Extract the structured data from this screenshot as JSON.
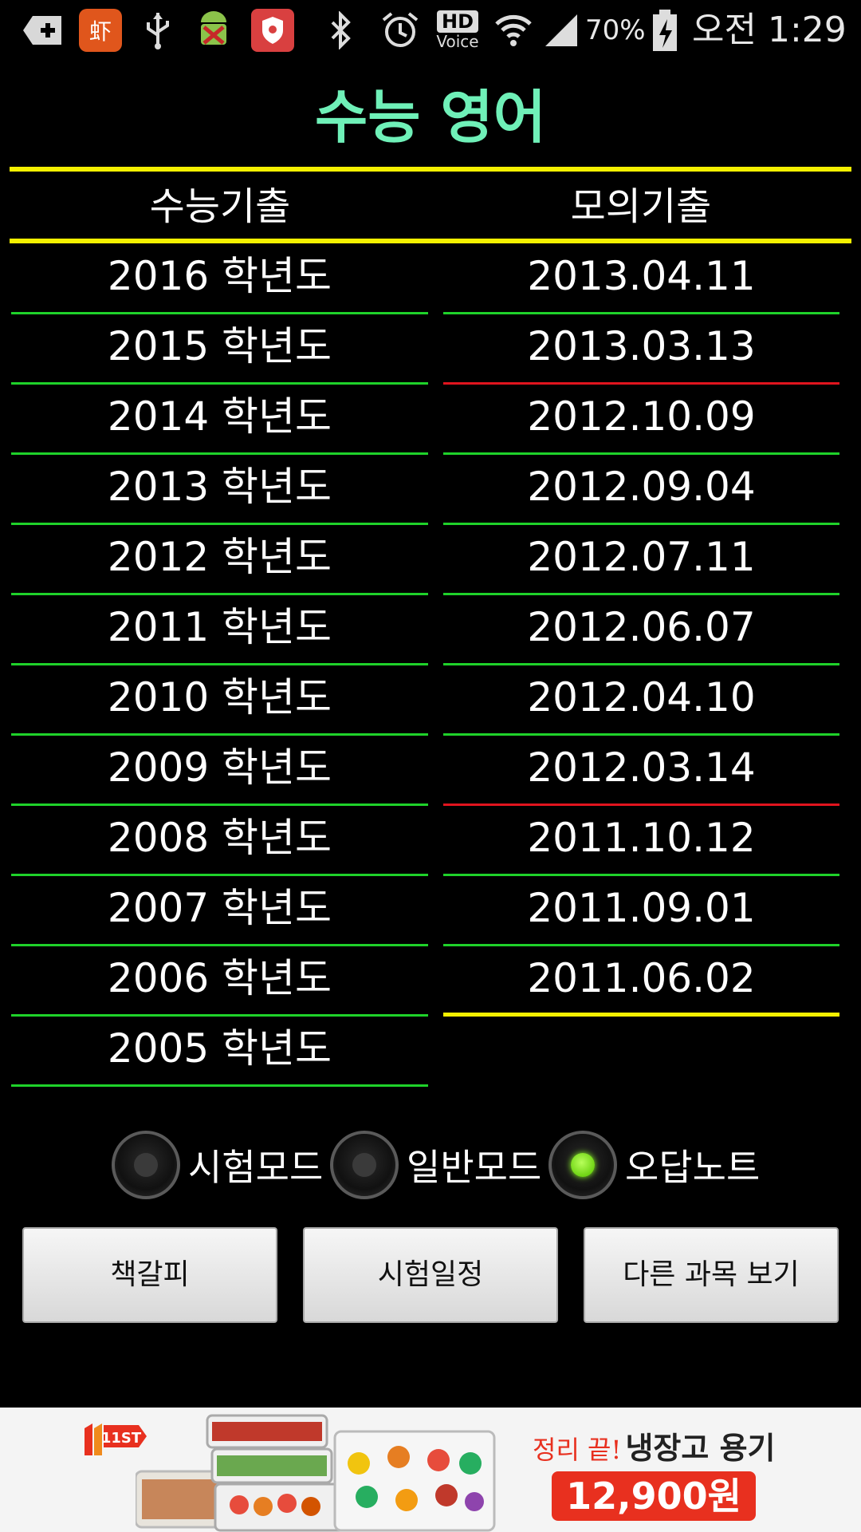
{
  "status_bar": {
    "icons": [
      "plus-icon",
      "app-icon",
      "usb-icon",
      "android-debug-icon",
      "shield-icon",
      "bluetooth-icon",
      "alarm-icon",
      "hd-voice-icon",
      "wifi-icon",
      "signal-icon",
      "battery-icon"
    ],
    "hd": "HD",
    "voice": "Voice",
    "battery": "70%",
    "time": "오전 1:29"
  },
  "title": "수능 영어",
  "columns": {
    "left_header": "수능기출",
    "right_header": "모의기출"
  },
  "suneung_items": [
    {
      "label": "2016 학년도",
      "line": "green"
    },
    {
      "label": "2015 학년도",
      "line": "green"
    },
    {
      "label": "2014 학년도",
      "line": "green"
    },
    {
      "label": "2013 학년도",
      "line": "green"
    },
    {
      "label": "2012 학년도",
      "line": "green"
    },
    {
      "label": "2011 학년도",
      "line": "green"
    },
    {
      "label": "2010 학년도",
      "line": "green"
    },
    {
      "label": "2009 학년도",
      "line": "green"
    },
    {
      "label": "2008 학년도",
      "line": "green"
    },
    {
      "label": "2007 학년도",
      "line": "green"
    },
    {
      "label": "2006 학년도",
      "line": "green"
    },
    {
      "label": "2005 학년도",
      "line": "green"
    }
  ],
  "mock_items": [
    {
      "label": "2013.04.11",
      "line": "green"
    },
    {
      "label": "2013.03.13",
      "line": "red"
    },
    {
      "label": "2012.10.09",
      "line": "green"
    },
    {
      "label": "2012.09.04",
      "line": "green"
    },
    {
      "label": "2012.07.11",
      "line": "green"
    },
    {
      "label": "2012.06.07",
      "line": "green"
    },
    {
      "label": "2012.04.10",
      "line": "green"
    },
    {
      "label": "2012.03.14",
      "line": "red"
    },
    {
      "label": "2011.10.12",
      "line": "green"
    },
    {
      "label": "2011.09.01",
      "line": "green"
    },
    {
      "label": "2011.06.02",
      "line": "yellow"
    }
  ],
  "modes": [
    {
      "label": "시험모드",
      "selected": false
    },
    {
      "label": "일반모드",
      "selected": false
    },
    {
      "label": "오답노트",
      "selected": true
    }
  ],
  "buttons": {
    "bookmark": "책갈피",
    "schedule": "시험일정",
    "other_subjects": "다른 과목 보기"
  },
  "ad": {
    "logo": "11ST",
    "tagline_prefix": "정리 끝!",
    "tagline": "냉장고 용기",
    "price": "12,900원"
  },
  "colors": {
    "title": "#6ff0b8",
    "divider_yellow": "#f5f000",
    "line_green": "#1fd22a",
    "line_red": "#e0141e",
    "radio_selected": "#8aff20",
    "ad_price_bg": "#e8301f"
  }
}
